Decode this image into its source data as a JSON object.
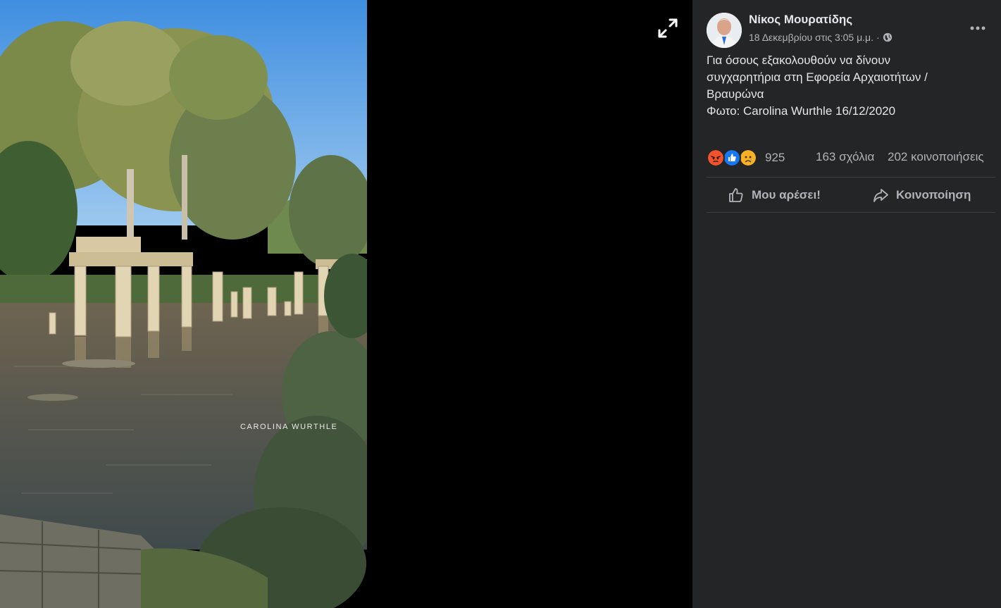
{
  "photo": {
    "watermark": "CAROLINA WURTHLE",
    "expand_icon": "expand-arrows-icon"
  },
  "post": {
    "author": "Νίκος Μουρατίδης",
    "date": "18 Δεκεμβρίου στις 3:05 μ.μ.",
    "separator": "·",
    "privacy_icon": "globe-icon",
    "more_icon": "more-dots-icon",
    "text_lines": [
      "Για όσους εξακολουθούν να δίνουν",
      "συγχαρητήρια στη Εφορεία Αρχαιοτήτων /",
      "Βραυρώνα",
      "Φωτο: Carolina Wurthle 16/12/2020"
    ]
  },
  "stats": {
    "reactions": [
      "angry",
      "like",
      "sad"
    ],
    "reaction_count": "925",
    "comments": "163 σχόλια",
    "shares": "202 κοινοποιήσεις"
  },
  "actions": {
    "like_label": "Μου αρέσει!",
    "share_label": "Κοινοποίηση"
  },
  "colors": {
    "panel_bg": "#242526",
    "text_primary": "#e4e6eb",
    "text_secondary": "#b0b3b8",
    "like_blue": "#1877f2",
    "angry": "#f0532d",
    "sad": "#f7b125"
  }
}
